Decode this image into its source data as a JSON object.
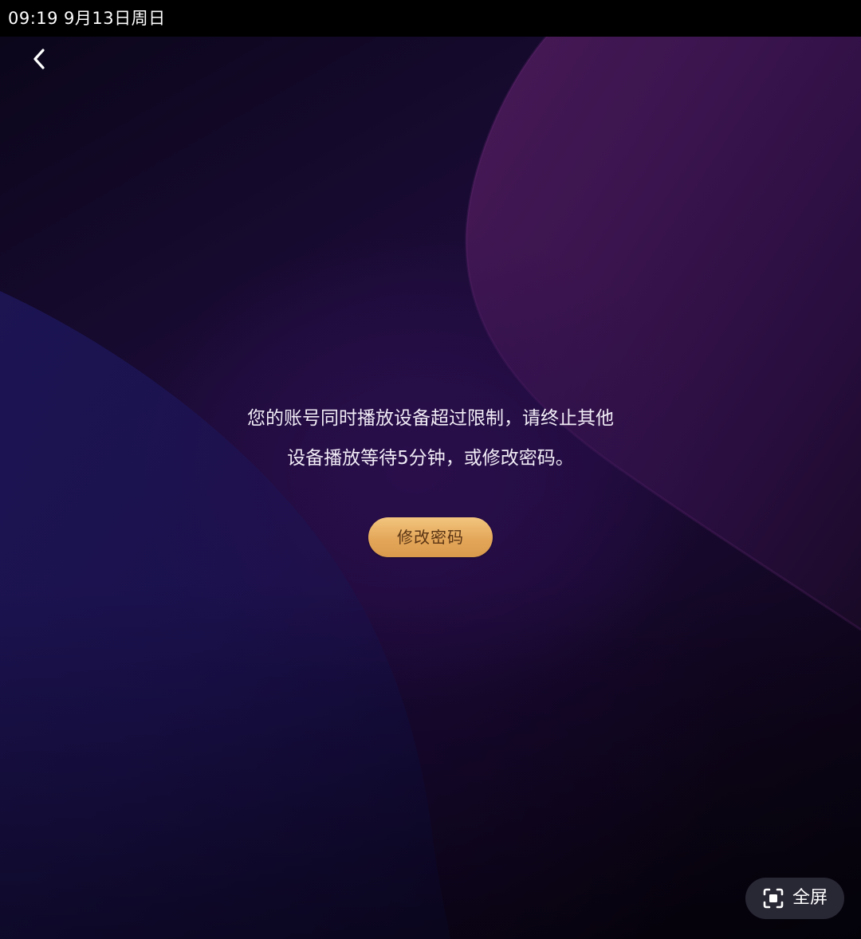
{
  "status_bar": {
    "time": "09:19",
    "date": "9月13日周日"
  },
  "navigation": {
    "back_icon": "chevron-left-icon"
  },
  "message": {
    "line1": "您的账号同时播放设备超过限制，请终止其他",
    "line2": "设备播放等待5分钟，或修改密码。"
  },
  "actions": {
    "change_password_label": "修改密码",
    "fullscreen_label": "全屏",
    "fullscreen_icon": "fullscreen-frame-icon"
  },
  "colors": {
    "button_gold": "#e4a75a",
    "button_text": "#5b3514",
    "background_purple": "#1a0b35",
    "accent_magenta": "#5a1f63"
  }
}
